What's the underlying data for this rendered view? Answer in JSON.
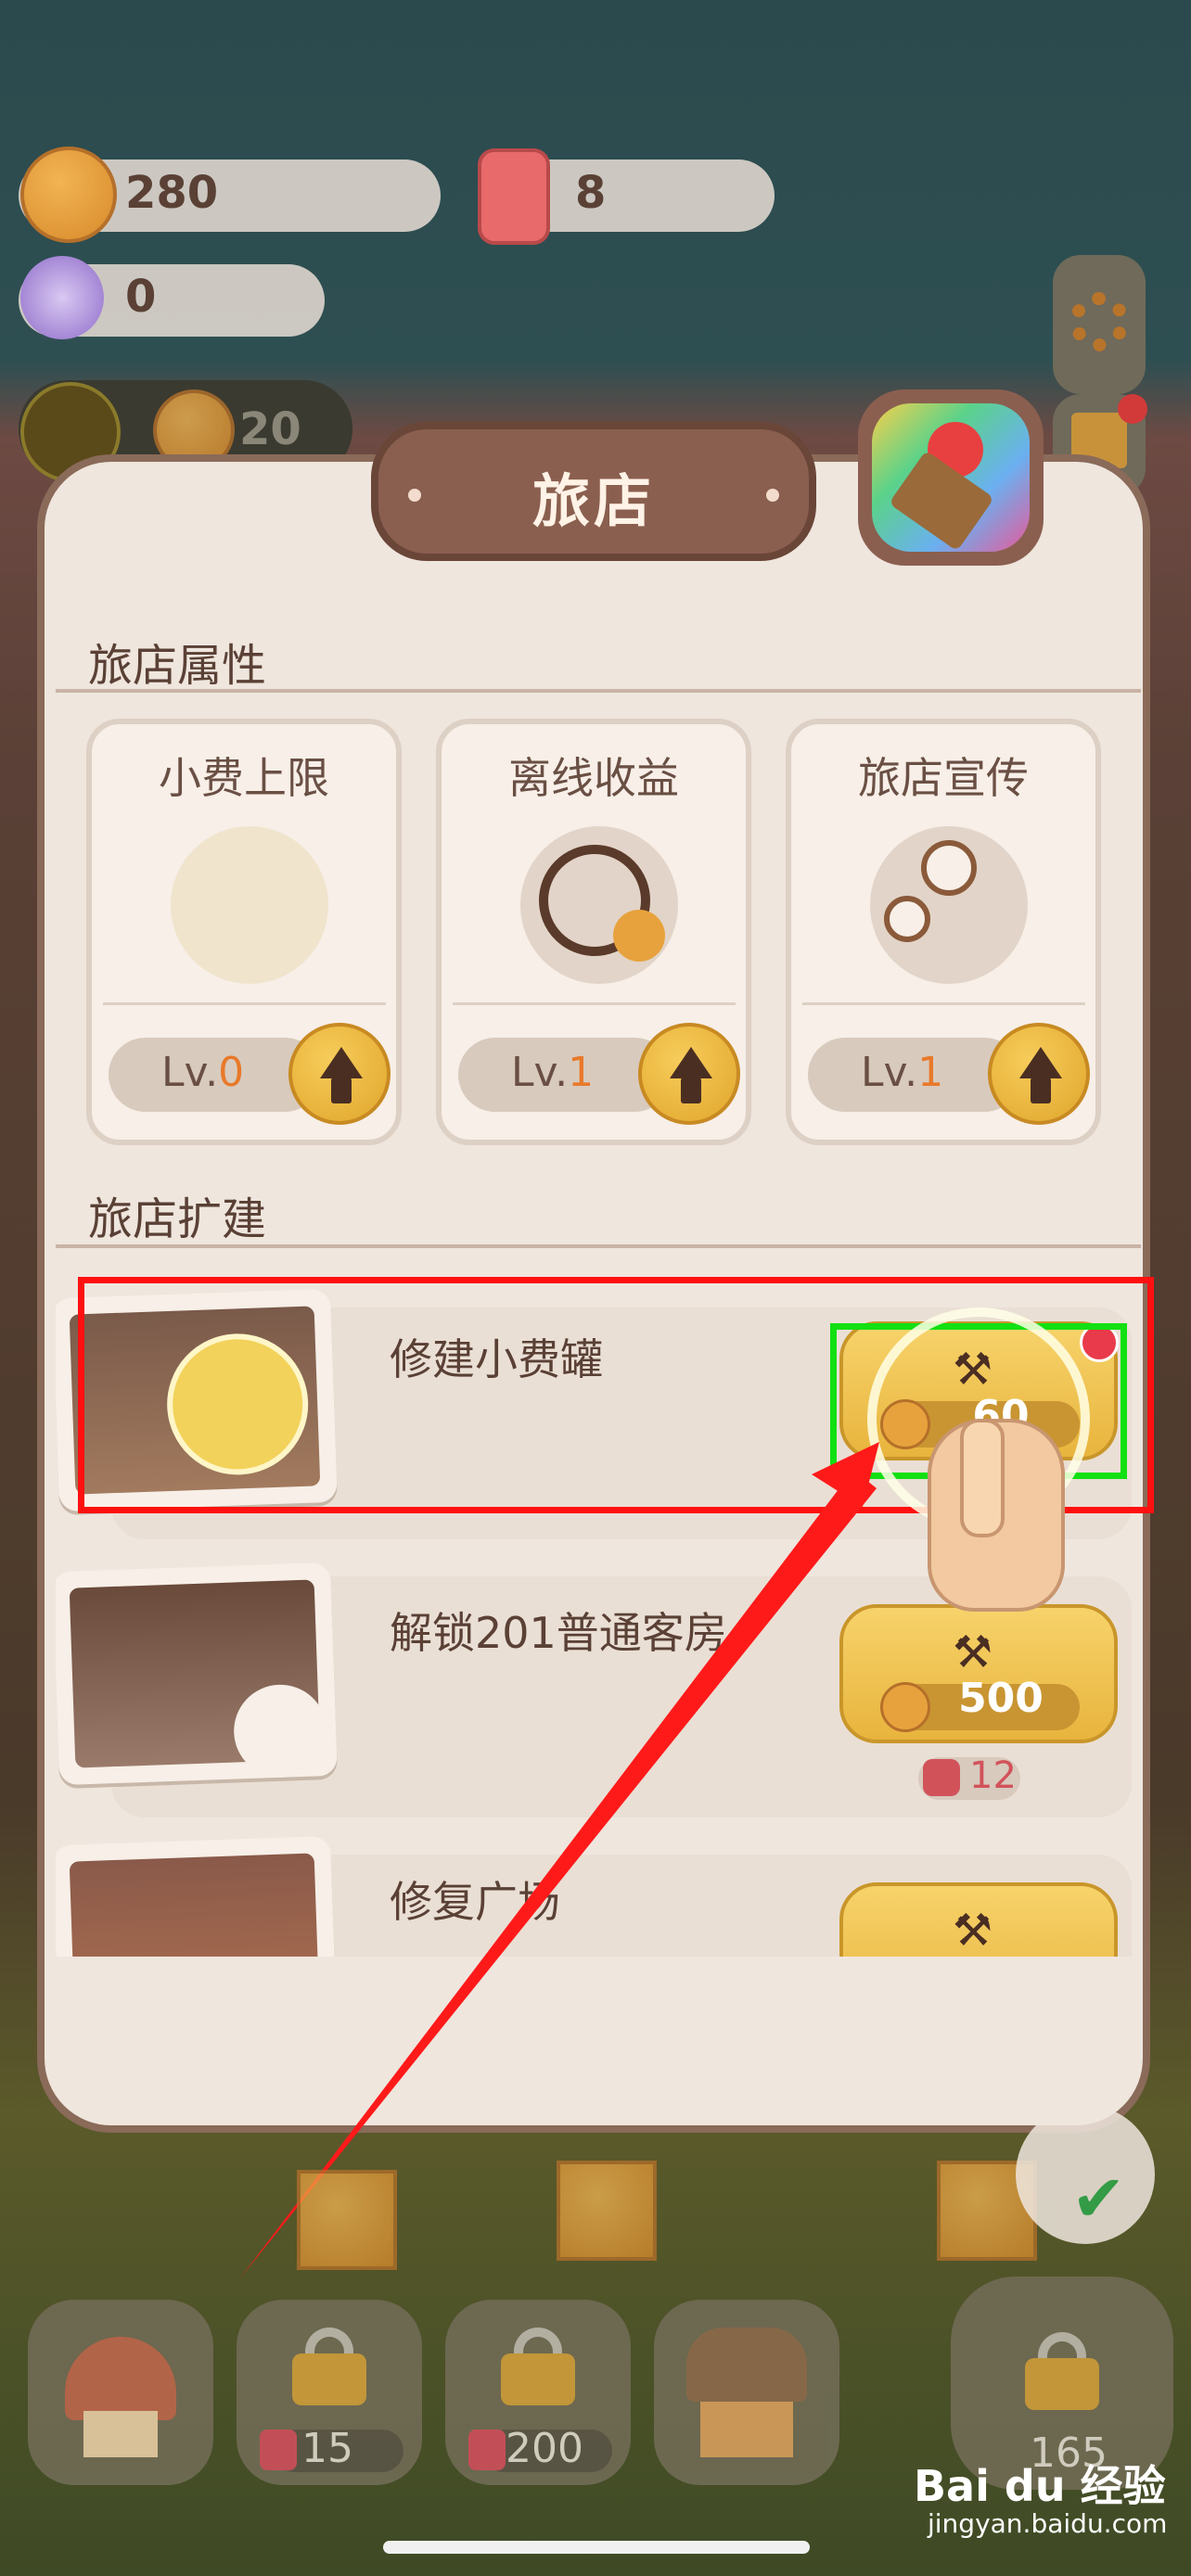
{
  "resources": {
    "cookies": "280",
    "candle": "8",
    "candy": "0",
    "visitors": "20"
  },
  "modal": {
    "title": "旅店"
  },
  "attributes": {
    "section_title": "旅店属性",
    "cards": [
      {
        "title": "小费上限",
        "level_prefix": "Lv.",
        "level": "0"
      },
      {
        "title": "离线收益",
        "level_prefix": "Lv.",
        "level": "1"
      },
      {
        "title": "旅店宣传",
        "level_prefix": "Lv.",
        "level": "1"
      }
    ]
  },
  "expansion": {
    "section_title": "旅店扩建",
    "items": [
      {
        "title": "修建小费罐",
        "cost": "60",
        "extra": ""
      },
      {
        "title": "解锁201普通客房",
        "cost": "500",
        "extra": "12"
      },
      {
        "title": "修复广场",
        "cost": "",
        "extra": ""
      }
    ]
  },
  "tabs": [
    {
      "count": ""
    },
    {
      "count": "15"
    },
    {
      "count": "200"
    },
    {
      "count": ""
    },
    {
      "count": "165"
    }
  ],
  "watermark": {
    "brand": "Bai du 经验",
    "url": "jingyan.baidu.com"
  },
  "colors": {
    "accent": "#e8792a",
    "highlight_red": "#ff1010",
    "highlight_green": "#12e012",
    "button_gold": "#e8b43d"
  }
}
